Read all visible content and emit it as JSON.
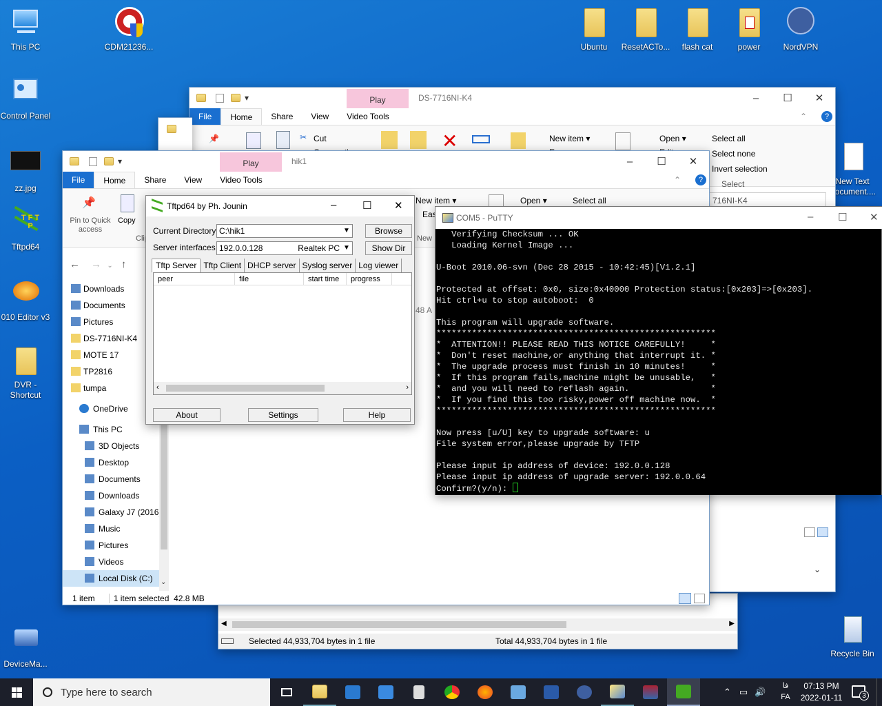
{
  "desktop_icons": [
    {
      "label": "This PC"
    },
    {
      "label": "CDM21236..."
    },
    {
      "label": "Control Panel"
    },
    {
      "label": "zz.jpg"
    },
    {
      "label": "Tftpd64"
    },
    {
      "label": "010 Editor v3"
    },
    {
      "label": "DVR - Shortcut"
    },
    {
      "label": "DeviceMa..."
    },
    {
      "label": "Ubuntu"
    },
    {
      "label": "ResetACTo..."
    },
    {
      "label": "flash cat"
    },
    {
      "label": "power"
    },
    {
      "label": "NordVPN"
    },
    {
      "label": "New Text Document...."
    },
    {
      "label": "Recycle Bin"
    }
  ],
  "explorer_back": {
    "play_tab": "Play",
    "title": "DS-7716NI-K4",
    "tabs": [
      "File",
      "Home",
      "Share",
      "View",
      "Video Tools"
    ],
    "cut": "Cut",
    "copy_path": "Copy path",
    "new_item": "New item ▾",
    "easy_access": "Easy access ▾",
    "open": "Open ▾",
    "edit": "Edit",
    "select_all": "Select all",
    "select_none": "Select none",
    "invert_selection": "Invert selection",
    "select_group": "Select",
    "address_fragment": "716NI-K4"
  },
  "explorer_front": {
    "play_tab": "Play",
    "title": "hik1",
    "tabs": [
      "File",
      "Home",
      "Share",
      "View",
      "Video Tools"
    ],
    "pin_label": "Pin to Quick access",
    "copy_label": "Copy",
    "clip_label": "Clip",
    "new_item": "New item ▾",
    "easy": "Easy",
    "new_short": "New",
    "open": "Open ▾",
    "select_all": "Select all",
    "time_fragment": "48 A",
    "nav": [
      {
        "label": "Downloads",
        "icon": "download-icon"
      },
      {
        "label": "Documents",
        "icon": "document-icon"
      },
      {
        "label": "Pictures",
        "icon": "pictures-icon"
      },
      {
        "label": "DS-7716NI-K4",
        "icon": "folder-icon"
      },
      {
        "label": "MOTE 17",
        "icon": "folder-icon"
      },
      {
        "label": "TP2816",
        "icon": "folder-icon"
      },
      {
        "label": "tumpa",
        "icon": "folder-icon"
      },
      {
        "label": "OneDrive",
        "icon": "cloud-icon"
      },
      {
        "label": "This PC",
        "icon": "computer-icon"
      },
      {
        "label": "3D Objects",
        "icon": "cube-icon"
      },
      {
        "label": "Desktop",
        "icon": "desktop-icon"
      },
      {
        "label": "Documents",
        "icon": "document-icon"
      },
      {
        "label": "Downloads",
        "icon": "download-icon"
      },
      {
        "label": "Galaxy J7 (2016)",
        "icon": "phone-icon"
      },
      {
        "label": "Music",
        "icon": "music-icon"
      },
      {
        "label": "Pictures",
        "icon": "pictures-icon"
      },
      {
        "label": "Videos",
        "icon": "video-icon"
      },
      {
        "label": "Local Disk (C:)",
        "icon": "disk-icon"
      }
    ],
    "status_items": "1 item",
    "status_selected": "1 item selected  42.8 MB"
  },
  "explorer_bottom": {
    "status_left": "Selected 44,933,704 bytes in 1 file",
    "status_right": "Total 44,933,704 bytes in 1 file"
  },
  "tftpd": {
    "title": "Tftpd64 by Ph. Jounin",
    "current_dir_label": "Current Directory",
    "current_dir_value": "C:\\hik1",
    "server_if_label": "Server interfaces",
    "server_if_ip": "192.0.0.128",
    "server_if_adapter": "Realtek PC",
    "browse": "Browse",
    "show_dir": "Show Dir",
    "tabs": [
      "Tftp Server",
      "Tftp Client",
      "DHCP server",
      "Syslog server",
      "Log viewer"
    ],
    "columns": [
      "peer",
      "file",
      "start time",
      "progress"
    ],
    "about": "About",
    "settings": "Settings",
    "help": "Help"
  },
  "putty": {
    "title": "COM5 - PuTTY",
    "lines": [
      "   Verifying Checksum ... OK",
      "   Loading Kernel Image ...",
      "",
      "U-Boot 2010.06-svn (Dec 28 2015 - 10:42:45)[V1.2.1]",
      "",
      "Protected at offset: 0x0, size:0x40000 Protection status:[0x203]=>[0x203].",
      "Hit ctrl+u to stop autoboot:  0",
      "",
      "This program will upgrade software.",
      "*******************************************************",
      "*  ATTENTION!! PLEASE READ THIS NOTICE CAREFULLY!     *",
      "*  Don't reset machine,or anything that interrupt it. *",
      "*  The upgrade process must finish in 10 minutes!     *",
      "*  If this program fails,machine might be unusable,   *",
      "*  and you will need to reflash again.                *",
      "*  If you find this too risky,power off machine now.  *",
      "*******************************************************",
      "",
      "Now press [u/U] key to upgrade software: u",
      "File system error,please upgrade by TFTP",
      "",
      "Please input ip address of device: 192.0.0.128",
      "Please input ip address of upgrade server: 192.0.0.64",
      "Confirm?(y/n): "
    ]
  },
  "taskbar": {
    "search_placeholder": "Type here to search",
    "lang_top": "فا",
    "lang": "FA",
    "time": "07:13 PM",
    "date": "2022-01-11",
    "notification_count": "3"
  },
  "colors": {
    "accent": "#1a6fd0",
    "play_tab": "#f7c6dc",
    "taskbar": "#1c1f2a",
    "terminal_bg": "#000000"
  }
}
